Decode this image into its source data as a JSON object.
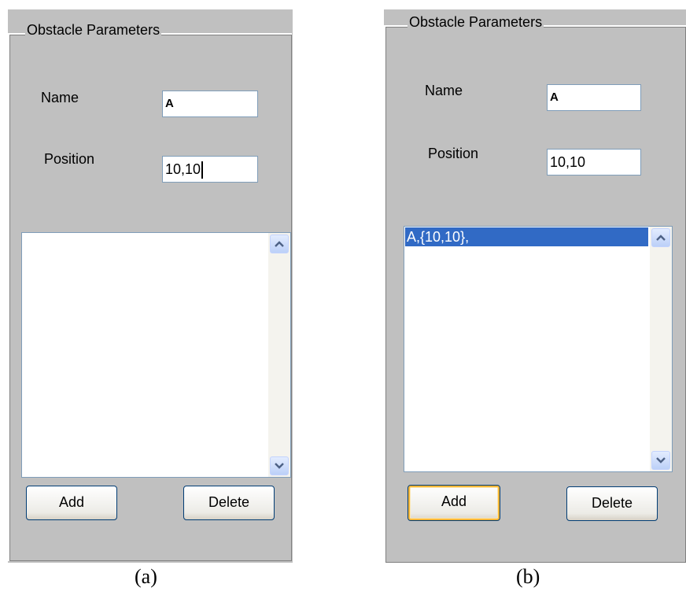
{
  "panels": [
    {
      "group_title": "Obstacle Parameters",
      "name_label": "Name",
      "name_value": "A",
      "position_label": "Position",
      "position_value": "10,10",
      "list_items": [],
      "add_button": "Add",
      "delete_button": "Delete",
      "caption": "(a)"
    },
    {
      "group_title": "Obstacle Parameters",
      "name_label": "Name",
      "name_value": "A",
      "position_label": "Position",
      "position_value": "10,10",
      "list_items": [
        "A,{10,10},"
      ],
      "add_button": "Add",
      "delete_button": "Delete",
      "caption": "(b)"
    }
  ],
  "colors": {
    "panel_bg": "#c0c0c0",
    "selection": "#316ac5",
    "focus_ring": "#f8b636"
  },
  "icons": {
    "scroll_up": "chevron-up-icon",
    "scroll_down": "chevron-down-icon"
  }
}
